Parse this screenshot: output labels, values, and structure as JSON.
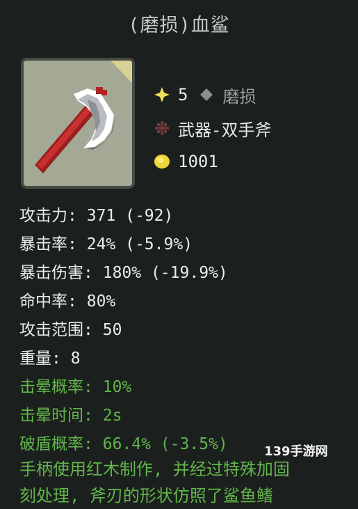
{
  "title": "(磨损)血鲨",
  "item": {
    "icon": "blood-axe",
    "stars": "5",
    "condition": "磨损",
    "category": "武器-双手斧",
    "price": "1001"
  },
  "attributes": [
    {
      "label": "攻击力:",
      "value": "371 (-92)",
      "color": "white"
    },
    {
      "label": "暴击率:",
      "value": "24% (-5.9%)",
      "color": "white"
    },
    {
      "label": "暴击伤害:",
      "value": "180% (-19.9%)",
      "color": "white"
    },
    {
      "label": "命中率:",
      "value": "80%",
      "color": "white"
    },
    {
      "label": "攻击范围:",
      "value": "50",
      "color": "white"
    },
    {
      "label": "重量:",
      "value": "8",
      "color": "white"
    },
    {
      "label": "击晕概率:",
      "value": "10%",
      "color": "green"
    },
    {
      "label": "击晕时间:",
      "value": "2s",
      "color": "green"
    },
    {
      "label": "破盾概率:",
      "value": "66.4% (-3.5%)",
      "color": "green"
    }
  ],
  "description": {
    "line1": "手柄使用红木制作, 并经过特殊加固",
    "line2": "刻处理, 斧刃的形状仿照了鲨鱼鳍"
  },
  "watermark": "139手游网",
  "colors": {
    "background": "#1b1f1d",
    "text": "#e9ecea",
    "green": "#61b64a",
    "icon_bg": "#a4a995"
  }
}
